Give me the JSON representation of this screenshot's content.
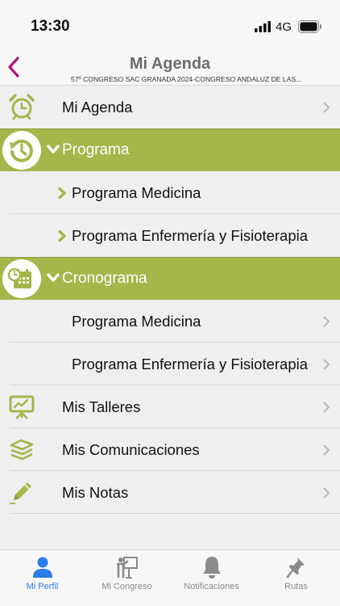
{
  "status": {
    "time": "13:30",
    "network": "4G"
  },
  "header": {
    "title": "Mi Agenda",
    "subtitle": "57º CONGRESO SAC GRANADA 2024-CONGRESO ANDALUZ DE LAS..."
  },
  "menu": {
    "mi_agenda": "Mi Agenda",
    "programa": {
      "label": "Programa",
      "items": [
        "Programa Medicina",
        "Programa Enfermería y Fisioterapia"
      ]
    },
    "cronograma": {
      "label": "Cronograma",
      "items": [
        "Programa Medicina",
        "Programa Enfermería y Fisioterapia"
      ]
    },
    "talleres": "Mis Talleres",
    "comunicaciones": "Mis Comunicaciones",
    "notas": "Mis Notas"
  },
  "tabs": [
    {
      "label": "Mi Perfil",
      "icon": "person-icon",
      "active": true
    },
    {
      "label": "Mi Congreso",
      "icon": "presenter-icon",
      "active": false
    },
    {
      "label": "Notificaciones",
      "icon": "bell-icon",
      "active": false
    },
    {
      "label": "Rutas",
      "icon": "pin-icon",
      "active": false
    }
  ],
  "colors": {
    "accent": "#a3b74a",
    "back": "#b0167a",
    "tab_active": "#2a7ee8",
    "tab_inactive": "#8a8a8a"
  }
}
